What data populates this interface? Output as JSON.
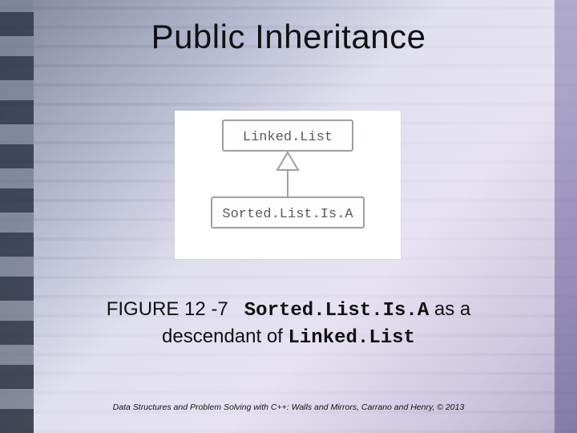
{
  "title": "Public Inheritance",
  "diagram": {
    "parent_box": "Linked.List",
    "child_box": "Sorted.List.Is.A"
  },
  "caption": {
    "fig_label": "FIGURE 12 -7",
    "class_a": "Sorted.List.Is.A",
    "mid_text_1": " as a",
    "line2_prefix": "descendant of ",
    "class_b": "Linked.List"
  },
  "footer": "Data Structures and Problem Solving with C++: Walls and Mirrors, Carrano and Henry, © 2013"
}
